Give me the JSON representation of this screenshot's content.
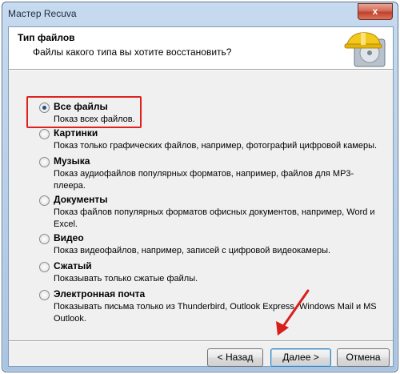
{
  "window": {
    "title": "Мастер Recuva",
    "close_glyph": "x"
  },
  "header": {
    "title": "Тип файлов",
    "subtitle": "Файлы какого типа вы хотите восстановить?"
  },
  "options": [
    {
      "label": "Все файлы",
      "description": "Показ всех файлов.",
      "selected": true
    },
    {
      "label": "Картинки",
      "description": "Показ только графических файлов, например, фотографий цифровой камеры."
    },
    {
      "label": "Музыка",
      "description": "Показ аудиофайлов популярных форматов, например, файлов для MP3-плеера."
    },
    {
      "label": "Документы",
      "description": "Показ файлов популярных форматов офисных документов, например, Word и Excel."
    },
    {
      "label": "Видео",
      "description": "Показ видеофайлов, например, записей с цифровой видеокамеры."
    },
    {
      "label": "Сжатый",
      "description": "Показывать только сжатые файлы."
    },
    {
      "label": "Электронная почта",
      "description": "Показывать письма только из Thunderbird, Outlook Express, Windows Mail и MS Outlook."
    }
  ],
  "buttons": {
    "back": "< Назад",
    "next": "Далее >",
    "cancel": "Отмена"
  },
  "colors": {
    "highlight": "#e0211f",
    "arrow": "#d7201c"
  }
}
